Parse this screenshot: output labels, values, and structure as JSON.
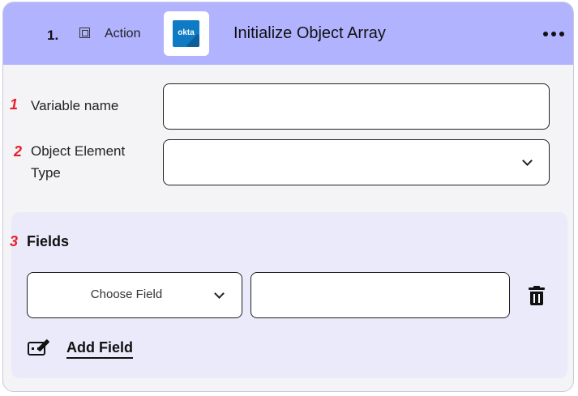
{
  "header": {
    "step_number": "1.",
    "action_label": "Action",
    "logo_text": "okta",
    "title": "Initialize Object Array",
    "more_icon": "more-horizontal-icon"
  },
  "form": {
    "variable_name": {
      "marker": "1",
      "label": "Variable name",
      "value": "",
      "placeholder": ""
    },
    "object_element_type": {
      "marker": "2",
      "label_line1": "Object Element",
      "label_line2": "Type",
      "value": ""
    }
  },
  "fields_section": {
    "marker": "3",
    "title": "Fields",
    "rows": [
      {
        "choose_field_label": "Choose Field",
        "value": ""
      }
    ],
    "add_field_label": "Add Field"
  },
  "colors": {
    "header_bg": "#b2b3ff",
    "card_bg": "#f4f4f7",
    "fields_panel_bg": "#eaeafb",
    "marker_red": "#e8202a",
    "okta_blue": "#0f7bc4"
  }
}
